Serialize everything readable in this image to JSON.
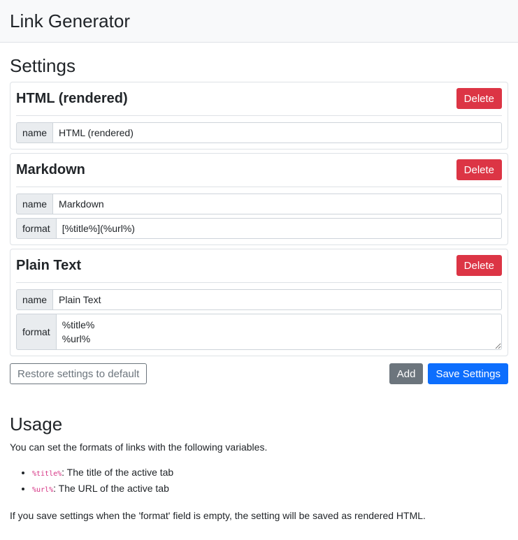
{
  "header": {
    "title": "Link Generator"
  },
  "settings": {
    "title": "Settings",
    "cards": [
      {
        "title": "HTML (rendered)",
        "delete_label": "Delete",
        "name_label": "name",
        "name_value": "HTML (rendered)"
      },
      {
        "title": "Markdown",
        "delete_label": "Delete",
        "name_label": "name",
        "name_value": "Markdown",
        "format_label": "format",
        "format_value": "[%title%](%url%)"
      },
      {
        "title": "Plain Text",
        "delete_label": "Delete",
        "name_label": "name",
        "name_value": "Plain Text",
        "format_label": "format",
        "format_value": "%title%\n%url%"
      }
    ],
    "restore_label": "Restore settings to default",
    "add_label": "Add",
    "save_label": "Save Settings"
  },
  "usage": {
    "title": "Usage",
    "intro": "You can set the formats of links with the following variables.",
    "variables": [
      {
        "code": "%title%",
        "desc": ": The title of the active tab"
      },
      {
        "code": "%url%",
        "desc": ": The URL of the active tab"
      }
    ],
    "note": "If you save settings when the 'format' field is empty, the setting will be saved as rendered HTML."
  }
}
